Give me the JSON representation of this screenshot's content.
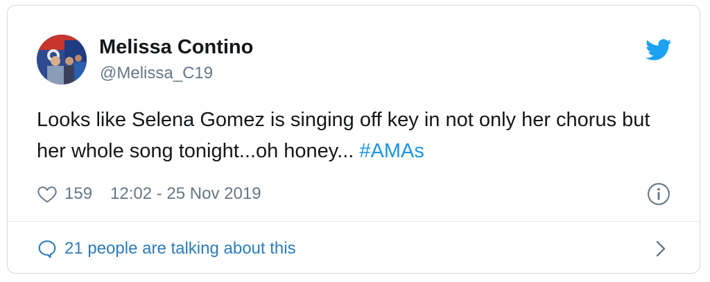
{
  "author": {
    "display_name": "Melissa Contino",
    "handle": "@Melissa_C19",
    "avatar_icon": "profile-photo"
  },
  "tweet": {
    "text": "Looks like Selena Gomez is singing off key in not only her chorus but her whole song tonight...oh honey...",
    "hashtag": "#AMAs"
  },
  "meta": {
    "like_count": "159",
    "timestamp": "12:02 - 25 Nov 2019"
  },
  "footer": {
    "conversation_label": "21 people are talking about this"
  },
  "icons": {
    "brand": "twitter-bird-icon",
    "like": "heart-icon",
    "info": "info-icon",
    "conversation": "speech-bubble-icon",
    "expand": "chevron-right-icon"
  },
  "colors": {
    "brand_blue": "#1da1f2",
    "link_blue": "#1b95e0",
    "text_primary": "#14171a",
    "text_secondary": "#657786",
    "border": "#cfd9de"
  }
}
